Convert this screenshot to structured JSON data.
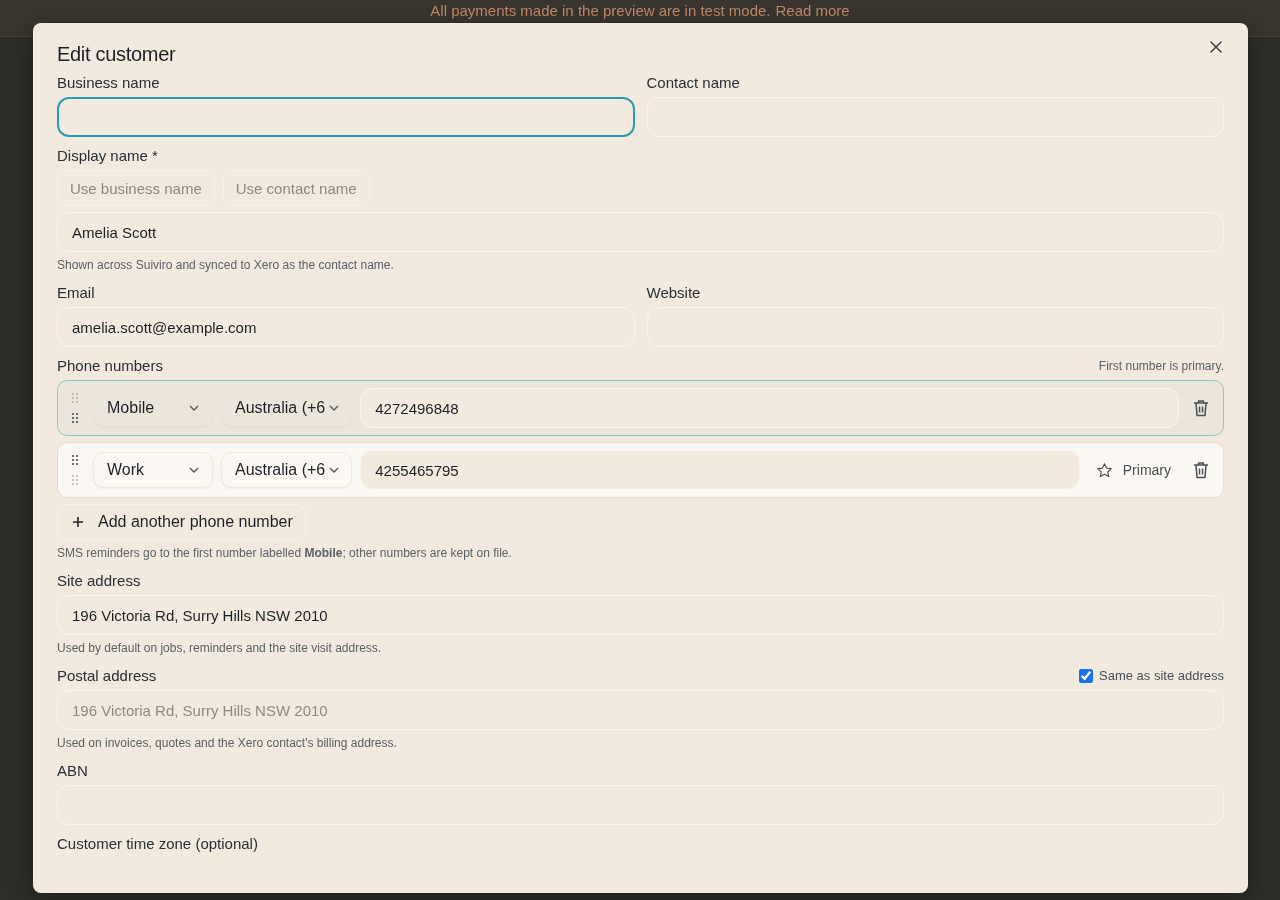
{
  "banner": {
    "text": "All payments made in the preview are in test mode.",
    "link": "Read more"
  },
  "dialog": {
    "title": "Edit customer",
    "business_name": {
      "label": "Business name",
      "focused": true
    },
    "contact_name": {
      "label": "Contact name",
      "focused": false
    },
    "display_name": {
      "label": "Display name *",
      "quick_buttons": [
        {
          "label": "Use business name",
          "disabled": true
        },
        {
          "label": "Use contact name",
          "disabled": true
        }
      ],
      "value": "Amelia Scott",
      "help": "Shown across Suiviro and synced to Xero as the contact name."
    },
    "email": {
      "label": "Email",
      "value": "amelia.scott@example.com"
    },
    "website": {
      "label": "Website"
    },
    "phones": {
      "label": "Phone numbers",
      "note": "First number is primary.",
      "rows": [
        {
          "type": "Mobile",
          "country": "Australia (+6",
          "number": "4272496848",
          "primary": true,
          "active": true
        },
        {
          "type": "Work",
          "country": "Australia (+6",
          "number": "4255465795",
          "primary": false,
          "active": false,
          "primary_button": "Primary"
        }
      ],
      "add_button": "Add another phone number",
      "help": "SMS reminders go to the first number labelled **Mobile**; other numbers are kept on file."
    },
    "site_address": {
      "label": "Site address",
      "value": "196 Victoria Rd, Surry Hills NSW 2010",
      "help": "Used by default on jobs, reminders and the site visit address."
    },
    "postal_address": {
      "label": "Postal address",
      "same_as_site": {
        "label": "Same as site address",
        "checked": true
      },
      "value": "196 Victoria Rd, Surry Hills NSW 2010",
      "help": "Used on invoices, quotes and the Xero contact's billing address."
    },
    "abn": {
      "label": "ABN"
    },
    "time_zone": {
      "label": "Customer time zone (optional)"
    }
  }
}
